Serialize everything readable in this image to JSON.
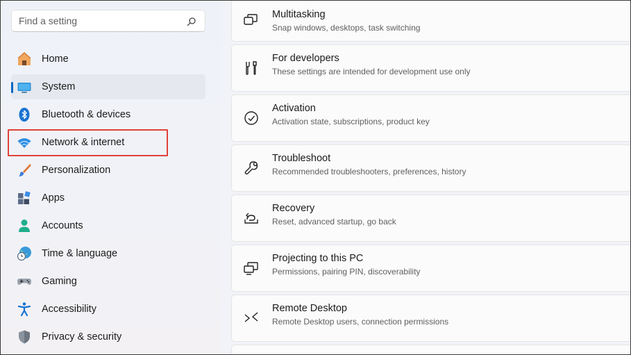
{
  "search": {
    "placeholder": "Find a setting"
  },
  "sidebar": {
    "items": [
      {
        "label": "Home",
        "icon": "home-icon"
      },
      {
        "label": "System",
        "icon": "system-icon",
        "selected": true
      },
      {
        "label": "Bluetooth & devices",
        "icon": "bluetooth-icon"
      },
      {
        "label": "Network & internet",
        "icon": "wifi-icon",
        "highlighted": true
      },
      {
        "label": "Personalization",
        "icon": "brush-icon"
      },
      {
        "label": "Apps",
        "icon": "apps-icon"
      },
      {
        "label": "Accounts",
        "icon": "person-icon"
      },
      {
        "label": "Time & language",
        "icon": "globe-clock-icon"
      },
      {
        "label": "Gaming",
        "icon": "gamepad-icon"
      },
      {
        "label": "Accessibility",
        "icon": "accessibility-icon"
      },
      {
        "label": "Privacy & security",
        "icon": "shield-icon"
      }
    ]
  },
  "main": {
    "cards": [
      {
        "title": "Multitasking",
        "desc": "Snap windows, desktops, task switching",
        "icon": "multitasking-icon"
      },
      {
        "title": "For developers",
        "desc": "These settings are intended for development use only",
        "icon": "developer-tools-icon"
      },
      {
        "title": "Activation",
        "desc": "Activation state, subscriptions, product key",
        "icon": "checkmark-circle-icon"
      },
      {
        "title": "Troubleshoot",
        "desc": "Recommended troubleshooters, preferences, history",
        "icon": "wrench-icon"
      },
      {
        "title": "Recovery",
        "desc": "Reset, advanced startup, go back",
        "icon": "recovery-icon"
      },
      {
        "title": "Projecting to this PC",
        "desc": "Permissions, pairing PIN, discoverability",
        "icon": "projecting-icon"
      },
      {
        "title": "Remote Desktop",
        "desc": "Remote Desktop users, connection permissions",
        "icon": "remote-desktop-icon"
      }
    ]
  },
  "colors": {
    "accent": "#0067c0",
    "highlight_box": "#e0413a"
  }
}
